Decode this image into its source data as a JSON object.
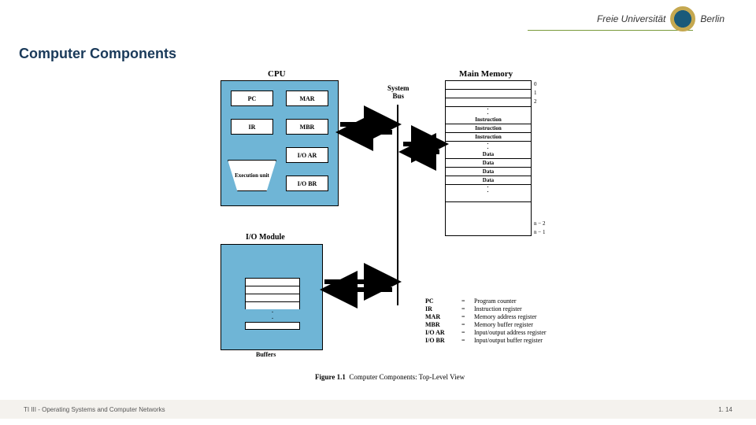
{
  "header": {
    "uni_freie": "Freie",
    "uni_univ": "Universität",
    "uni_berlin": "Berlin"
  },
  "title": "Computer Components",
  "cpu": {
    "label": "CPU",
    "pc": "PC",
    "mar": "MAR",
    "ir": "IR",
    "mbr": "MBR",
    "ioar": "I/O AR",
    "iobr": "I/O BR",
    "exec": "Execution unit"
  },
  "memory": {
    "label": "Main Memory",
    "addr0": "0",
    "addr1": "1",
    "addr2": "2",
    "addrN2": "n − 2",
    "addrN1": "n − 1",
    "instr": "Instruction",
    "data": "Data"
  },
  "io": {
    "label": "I/O Module",
    "buffers": "Buffers"
  },
  "bus": {
    "label": "System\nBus"
  },
  "legend": {
    "rows": [
      {
        "abbr": "PC",
        "desc": "Program counter"
      },
      {
        "abbr": "IR",
        "desc": "Instruction register"
      },
      {
        "abbr": "MAR",
        "desc": "Memory address register"
      },
      {
        "abbr": "MBR",
        "desc": "Memory buffer register"
      },
      {
        "abbr": "I/O AR",
        "desc": "Input/output address register"
      },
      {
        "abbr": "I/O BR",
        "desc": "Input/output buffer register"
      }
    ]
  },
  "caption": {
    "fig": "Figure 1.1",
    "text": "Computer Components: Top-Level View"
  },
  "footer": {
    "left": "TI III - Operating Systems and Computer Networks",
    "right": "1. 14"
  }
}
